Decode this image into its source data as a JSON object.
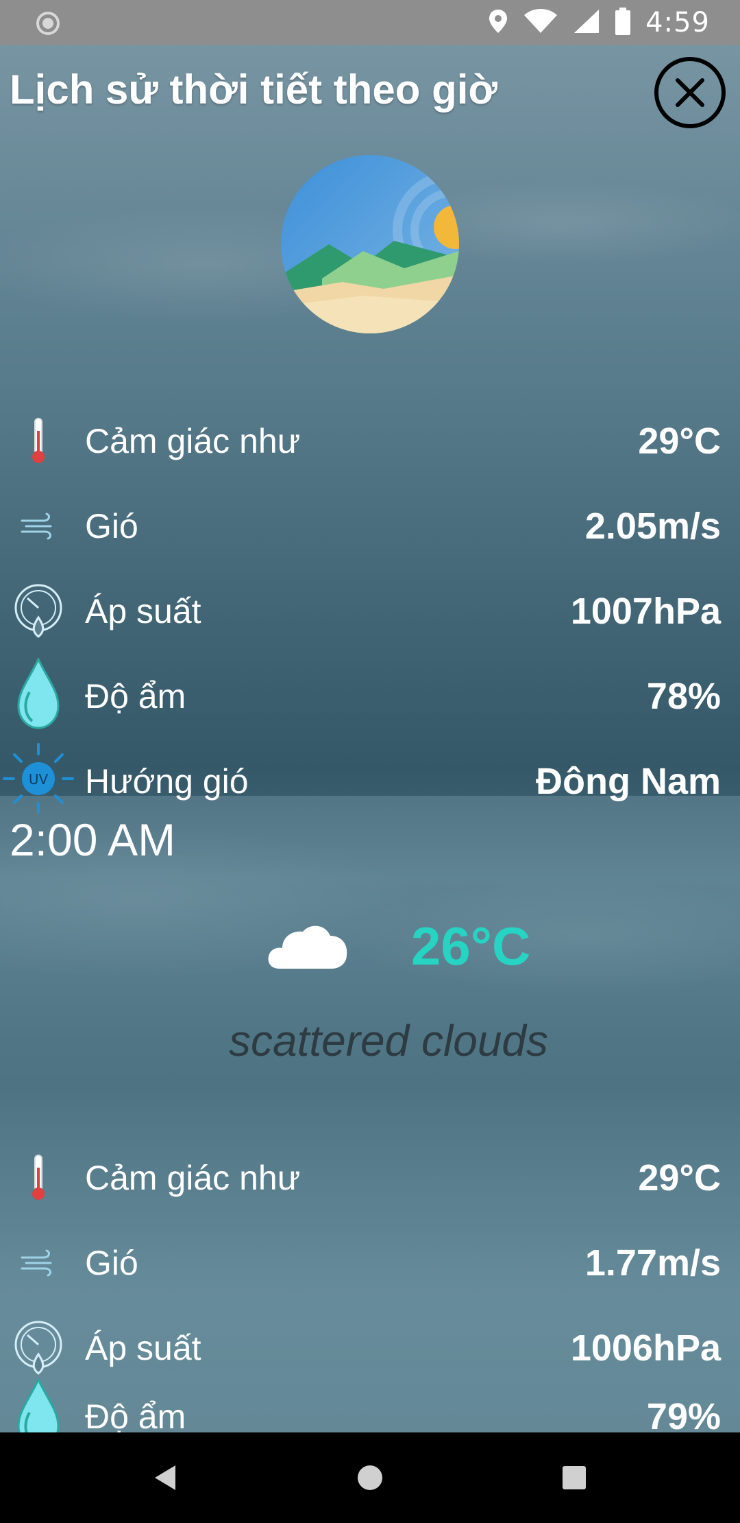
{
  "status_bar": {
    "time": "4:59",
    "icons": [
      "sync-icon",
      "location-icon",
      "wifi-icon",
      "signal-icon",
      "battery-icon"
    ]
  },
  "header": {
    "title": "Lịch sử thời tiết theo giờ",
    "close_icon": "close-icon"
  },
  "current": {
    "illustration": "landscape-sun-illustration",
    "rows": [
      {
        "icon": "thermometer-icon",
        "label": "Cảm giác như",
        "value": "29°C"
      },
      {
        "icon": "wind-icon",
        "label": "Gió",
        "value": "2.05m/s"
      },
      {
        "icon": "pressure-gauge-icon",
        "label": "Áp suất",
        "value": "1007hPa"
      },
      {
        "icon": "humidity-drop-icon",
        "label": "Độ ẩm",
        "value": "78%"
      },
      {
        "icon": "uv-sun-icon",
        "label": "Hướng gió",
        "value": "Đông Nam"
      }
    ]
  },
  "hourly": {
    "time": "2:00 AM",
    "icon": "cloud-icon",
    "temperature": "26°C",
    "description": "scattered clouds",
    "rows": [
      {
        "icon": "thermometer-icon",
        "label": "Cảm giác như",
        "value": "29°C"
      },
      {
        "icon": "wind-icon",
        "label": "Gió",
        "value": "1.77m/s"
      },
      {
        "icon": "pressure-gauge-icon",
        "label": "Áp suất",
        "value": "1006hPa"
      },
      {
        "icon": "humidity-drop-icon",
        "label": "Độ ẩm",
        "value": "79%"
      }
    ]
  },
  "colors": {
    "accent_temperature": "#27d3c3",
    "status_bar": "#8e8e8e",
    "nav_bar": "#000000",
    "text": "#ffffff"
  },
  "nav_bar": {
    "buttons": [
      "back-icon",
      "home-icon",
      "recents-icon"
    ]
  }
}
